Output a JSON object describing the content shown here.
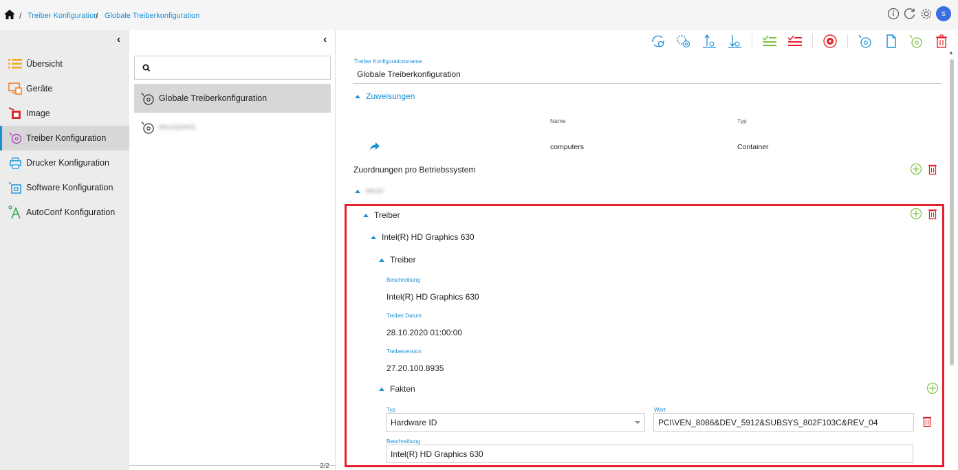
{
  "breadcrumb": {
    "items": [
      "Treiber Konfiguration",
      "Globale Treiberkonfiguration"
    ],
    "separator": "/"
  },
  "header": {
    "avatar_initial": "S"
  },
  "sidebar": {
    "items": [
      {
        "label": "Übersicht",
        "icon": "list-icon"
      },
      {
        "label": "Geräte",
        "icon": "devices-icon"
      },
      {
        "label": "Image",
        "icon": "image-icon"
      },
      {
        "label": "Treiber Konfiguration",
        "icon": "driver-disc-icon"
      },
      {
        "label": "Drucker Konfiguration",
        "icon": "printer-icon"
      },
      {
        "label": "Software Konfiguration",
        "icon": "software-icon"
      },
      {
        "label": "AutoConf Konfiguration",
        "icon": "autoconf-icon"
      }
    ],
    "active_index": 3
  },
  "list": {
    "items": [
      {
        "label": "Globale Treiberkonfiguration"
      },
      {
        "label": "Win10(24H2)"
      }
    ],
    "pager": "2/2"
  },
  "form": {
    "name_label": "Treiber Konfigurationsname",
    "name_value": "Globale Treiberkonfiguration",
    "assignments": {
      "title": "Zuweisungen",
      "col_name": "Name",
      "col_type": "Typ",
      "row_name": "computers",
      "row_type": "Container"
    },
    "os_mapping_title": "Zuordnungen pro Betriebssystem",
    "os_name": "Win10",
    "drivers_title": "Treiber",
    "device_title": "Intel(R) HD Graphics 630",
    "driver_sub_title": "Treiber",
    "desc_label": "Beschreibung",
    "desc_value": "Intel(R) HD Graphics 630",
    "date_label": "Treiber Datum",
    "date_value": "28.10.2020 01:00:00",
    "version_label": "Treiberversion",
    "version_value": "27.20.100.8935",
    "facts_title": "Fakten",
    "fact_type_label": "Typ",
    "fact_type_value": "Hardware ID",
    "fact_value_label": "Wert",
    "fact_value_value": "PCI\\VEN_8086&DEV_5912&SUBSYS_802F103C&REV_04",
    "fact_desc_label": "Beschreibung",
    "fact_desc_value": "Intel(R) HD Graphics 630"
  },
  "colors": {
    "accent": "#1a8fd6",
    "add": "#7cc241",
    "delete": "#e3202b",
    "highlight": "#e3202b"
  }
}
